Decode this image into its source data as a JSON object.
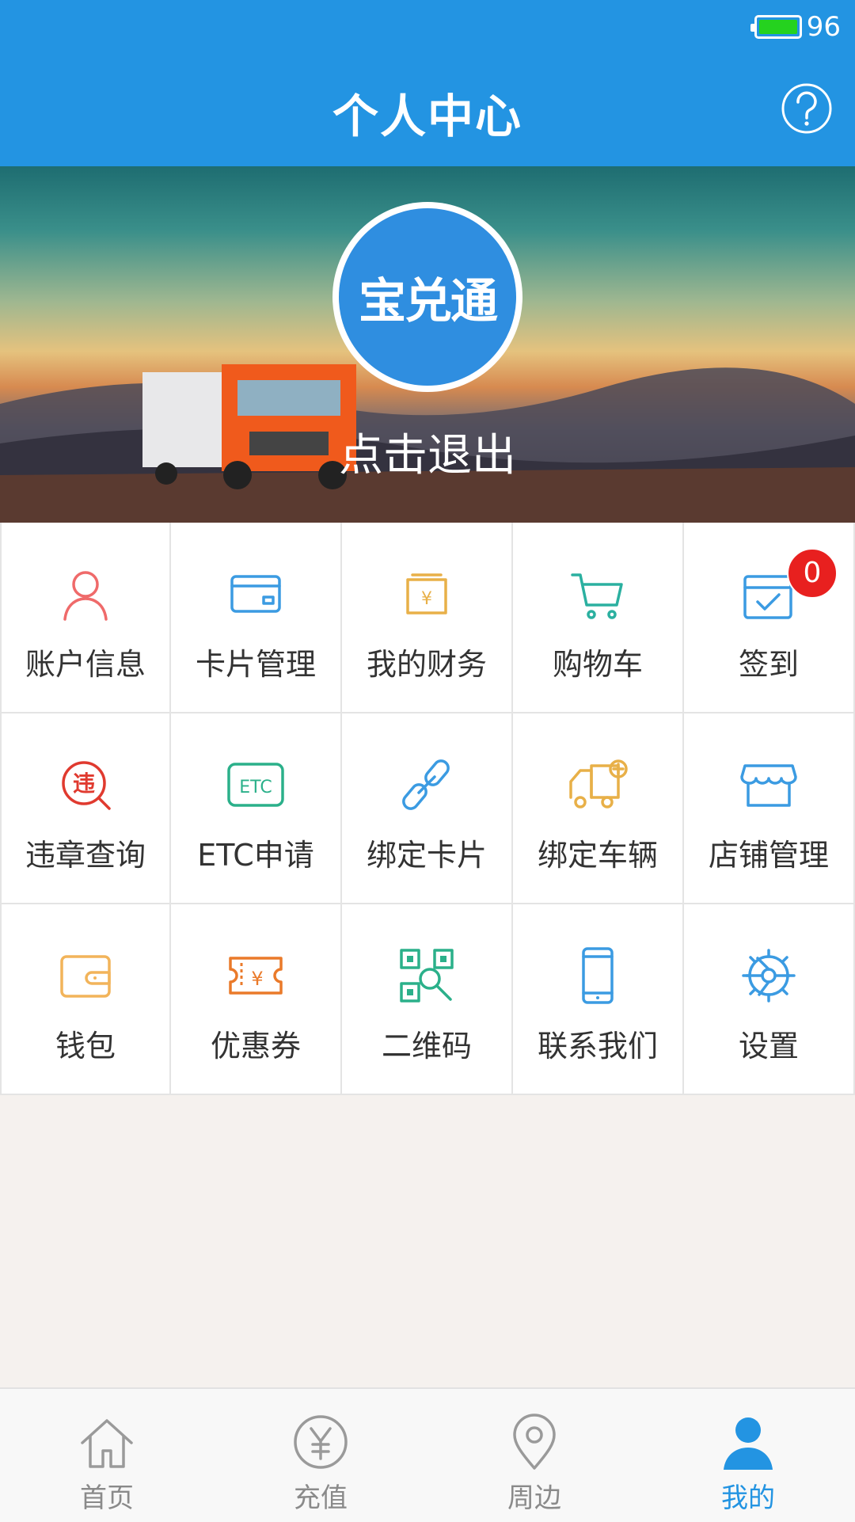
{
  "status": {
    "battery_level": "96"
  },
  "header": {
    "title": "个人中心"
  },
  "profile": {
    "logo_text": "宝兑通",
    "logout_text": "点击退出"
  },
  "grid": [
    {
      "label": "账户信息",
      "icon": "user-icon",
      "color": "#ef6a6a"
    },
    {
      "label": "卡片管理",
      "icon": "card-icon",
      "color": "#3b9be2"
    },
    {
      "label": "我的财务",
      "icon": "finance-icon",
      "color": "#e8b048"
    },
    {
      "label": "购物车",
      "icon": "cart-icon",
      "color": "#2bb0a0"
    },
    {
      "label": "签到",
      "icon": "checkin-icon",
      "color": "#3b9be2",
      "badge": "0"
    },
    {
      "label": "违章查询",
      "icon": "violation-search-icon",
      "color": "#e03a2f"
    },
    {
      "label": "ETC申请",
      "icon": "etc-icon",
      "color": "#2bb08a"
    },
    {
      "label": "绑定卡片",
      "icon": "link-icon",
      "color": "#3b9be2"
    },
    {
      "label": "绑定车辆",
      "icon": "truck-add-icon",
      "color": "#e8b048"
    },
    {
      "label": "店铺管理",
      "icon": "store-icon",
      "color": "#3b9be2"
    },
    {
      "label": "钱包",
      "icon": "wallet-icon",
      "color": "#f2b45a"
    },
    {
      "label": "优惠券",
      "icon": "coupon-icon",
      "color": "#ea7a2a"
    },
    {
      "label": "二维码",
      "icon": "qrcode-icon",
      "color": "#2bb08a"
    },
    {
      "label": "联系我们",
      "icon": "phone-icon",
      "color": "#3b9be2"
    },
    {
      "label": "设置",
      "icon": "settings-icon",
      "color": "#3b9be2"
    }
  ],
  "bottom_nav": [
    {
      "label": "首页",
      "icon": "home-icon"
    },
    {
      "label": "充值",
      "icon": "yuan-icon"
    },
    {
      "label": "周边",
      "icon": "location-icon"
    },
    {
      "label": "我的",
      "icon": "profile-icon",
      "active": true
    }
  ],
  "colors": {
    "primary": "#2394e2",
    "inactive": "#8a8a8a",
    "badge": "#e8201f"
  }
}
